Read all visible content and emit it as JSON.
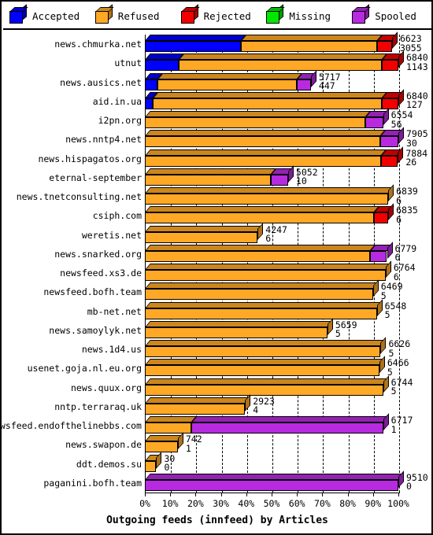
{
  "legend": {
    "items": [
      {
        "label": "Accepted",
        "color": "#0000ff",
        "icon": "cube-icon"
      },
      {
        "label": "Refused",
        "color": "#ffa826",
        "icon": "cube-icon"
      },
      {
        "label": "Rejected",
        "color": "#f20000",
        "icon": "cube-icon"
      },
      {
        "label": "Missing",
        "color": "#00e800",
        "icon": "cube-icon"
      },
      {
        "label": "Spooled",
        "color": "#b82ae0",
        "icon": "cube-icon"
      }
    ]
  },
  "axis": {
    "x_title": "Outgoing feeds (innfeed) by Articles",
    "x_ticks": [
      "0%",
      "10%",
      "20%",
      "30%",
      "40%",
      "50%",
      "60%",
      "70%",
      "80%",
      "90%",
      "100%"
    ],
    "x_tick_values": [
      0,
      10,
      20,
      30,
      40,
      50,
      60,
      70,
      80,
      90,
      100
    ]
  },
  "chart_data": {
    "type": "bar",
    "orientation": "horizontal",
    "stacked": true,
    "normalized": true,
    "title": "Outgoing feeds (innfeed) by Articles",
    "xlabel": "Outgoing feeds (innfeed) by Articles",
    "ylabel": "",
    "xlim": [
      0,
      100
    ],
    "grid": true,
    "legend_position": "top",
    "series_names": [
      "Accepted",
      "Refused",
      "Rejected",
      "Missing",
      "Spooled"
    ],
    "series_colors": [
      "#0000ff",
      "#ffa826",
      "#f20000",
      "#00e800",
      "#b82ae0"
    ],
    "categories": [
      "news.chmurka.net",
      "utnut",
      "news.ausics.net",
      "aid.in.ua",
      "i2pn.org",
      "news.nntp4.net",
      "news.hispagatos.org",
      "eternal-september",
      "news.tnetconsulting.net",
      "csiph.com",
      "weretis.net",
      "news.snarked.org",
      "newsfeed.xs3.de",
      "newsfeed.bofh.team",
      "mb-net.net",
      "news.samoylyk.net",
      "news.1d4.us",
      "usenet.goja.nl.eu.org",
      "news.quux.org",
      "nntp.terraraq.uk",
      "newsfeed.endofthelinebbs.com",
      "news.swapon.de",
      "ddt.demos.su",
      "paganini.bofh.team"
    ],
    "rows": [
      {
        "feed": "news.chmurka.net",
        "total": 6623,
        "second": 3055,
        "pct": 97.5,
        "segments": [
          {
            "name": "Accepted",
            "pct": 39.0
          },
          {
            "name": "Refused",
            "pct": 55.0
          },
          {
            "name": "Rejected",
            "pct": 6.0
          }
        ]
      },
      {
        "feed": "utnut",
        "total": 6840,
        "second": 1143,
        "pct": 100.0,
        "segments": [
          {
            "name": "Accepted",
            "pct": 13.5
          },
          {
            "name": "Refused",
            "pct": 80.0
          },
          {
            "name": "Rejected",
            "pct": 6.5
          }
        ]
      },
      {
        "feed": "news.ausics.net",
        "total": 5717,
        "second": 447,
        "pct": 65.5,
        "segments": [
          {
            "name": "Accepted",
            "pct": 7.5
          },
          {
            "name": "Refused",
            "pct": 84.0
          },
          {
            "name": "Spooled",
            "pct": 8.5
          }
        ]
      },
      {
        "feed": "aid.in.ua",
        "total": 6840,
        "second": 127,
        "pct": 100.0,
        "segments": [
          {
            "name": "Accepted",
            "pct": 3.0
          },
          {
            "name": "Refused",
            "pct": 90.5
          },
          {
            "name": "Rejected",
            "pct": 6.5
          }
        ]
      },
      {
        "feed": "i2pn.org",
        "total": 6554,
        "second": 56,
        "pct": 94.0,
        "segments": [
          {
            "name": "Refused",
            "pct": 92.5
          },
          {
            "name": "Spooled",
            "pct": 7.5
          }
        ]
      },
      {
        "feed": "news.nntp4.net",
        "total": 7905,
        "second": 30,
        "pct": 100.0,
        "segments": [
          {
            "name": "Refused",
            "pct": 93.0
          },
          {
            "name": "Spooled",
            "pct": 7.0
          }
        ]
      },
      {
        "feed": "news.hispagatos.org",
        "total": 7884,
        "second": 26,
        "pct": 99.8,
        "segments": [
          {
            "name": "Refused",
            "pct": 93.5
          },
          {
            "name": "Rejected",
            "pct": 6.5
          }
        ]
      },
      {
        "feed": "eternal-september",
        "total": 5052,
        "second": 10,
        "pct": 56.5,
        "segments": [
          {
            "name": "Refused",
            "pct": 88.0
          },
          {
            "name": "Spooled",
            "pct": 12.0
          }
        ]
      },
      {
        "feed": "news.tnetconsulting.net",
        "total": 6839,
        "second": 6,
        "pct": 96.0,
        "segments": [
          {
            "name": "Refused",
            "pct": 100.0
          }
        ]
      },
      {
        "feed": "csiph.com",
        "total": 6835,
        "second": 6,
        "pct": 96.0,
        "segments": [
          {
            "name": "Refused",
            "pct": 94.0
          },
          {
            "name": "Rejected",
            "pct": 6.0
          }
        ]
      },
      {
        "feed": "weretis.net",
        "total": 4247,
        "second": 6,
        "pct": 44.5,
        "segments": [
          {
            "name": "Refused",
            "pct": 100.0
          }
        ]
      },
      {
        "feed": "news.snarked.org",
        "total": 6779,
        "second": 6,
        "pct": 95.5,
        "segments": [
          {
            "name": "Refused",
            "pct": 93.0
          },
          {
            "name": "Spooled",
            "pct": 7.0
          }
        ]
      },
      {
        "feed": "newsfeed.xs3.de",
        "total": 6764,
        "second": 6,
        "pct": 95.0,
        "segments": [
          {
            "name": "Refused",
            "pct": 100.0
          }
        ]
      },
      {
        "feed": "newsfeed.bofh.team",
        "total": 6469,
        "second": 5,
        "pct": 90.0,
        "segments": [
          {
            "name": "Refused",
            "pct": 100.0
          }
        ]
      },
      {
        "feed": "mb-net.net",
        "total": 6548,
        "second": 5,
        "pct": 91.5,
        "segments": [
          {
            "name": "Refused",
            "pct": 100.0
          }
        ]
      },
      {
        "feed": "news.samoylyk.net",
        "total": 5659,
        "second": 5,
        "pct": 72.0,
        "segments": [
          {
            "name": "Refused",
            "pct": 100.0
          }
        ]
      },
      {
        "feed": "news.1d4.us",
        "total": 6626,
        "second": 5,
        "pct": 93.0,
        "segments": [
          {
            "name": "Refused",
            "pct": 100.0
          }
        ]
      },
      {
        "feed": "usenet.goja.nl.eu.org",
        "total": 6466,
        "second": 5,
        "pct": 92.5,
        "segments": [
          {
            "name": "Refused",
            "pct": 100.0
          }
        ]
      },
      {
        "feed": "news.quux.org",
        "total": 6744,
        "second": 5,
        "pct": 94.0,
        "segments": [
          {
            "name": "Refused",
            "pct": 100.0
          }
        ]
      },
      {
        "feed": "nntp.terraraq.uk",
        "total": 2923,
        "second": 4,
        "pct": 39.5,
        "segments": [
          {
            "name": "Refused",
            "pct": 100.0
          }
        ]
      },
      {
        "feed": "newsfeed.endofthelinebbs.com",
        "total": 6717,
        "second": 1,
        "pct": 94.0,
        "segments": [
          {
            "name": "Refused",
            "pct": 19.5
          },
          {
            "name": "Spooled",
            "pct": 80.5
          }
        ]
      },
      {
        "feed": "news.swapon.de",
        "total": 742,
        "second": 1,
        "pct": 13.0,
        "segments": [
          {
            "name": "Refused",
            "pct": 100.0
          }
        ]
      },
      {
        "feed": "ddt.demos.su",
        "total": 30,
        "second": 0,
        "pct": 4.5,
        "segments": [
          {
            "name": "Refused",
            "pct": 100.0
          }
        ]
      },
      {
        "feed": "paganini.bofh.team",
        "total": 9510,
        "second": 0,
        "pct": 100.0,
        "segments": [
          {
            "name": "Spooled",
            "pct": 100.0
          }
        ]
      }
    ]
  }
}
